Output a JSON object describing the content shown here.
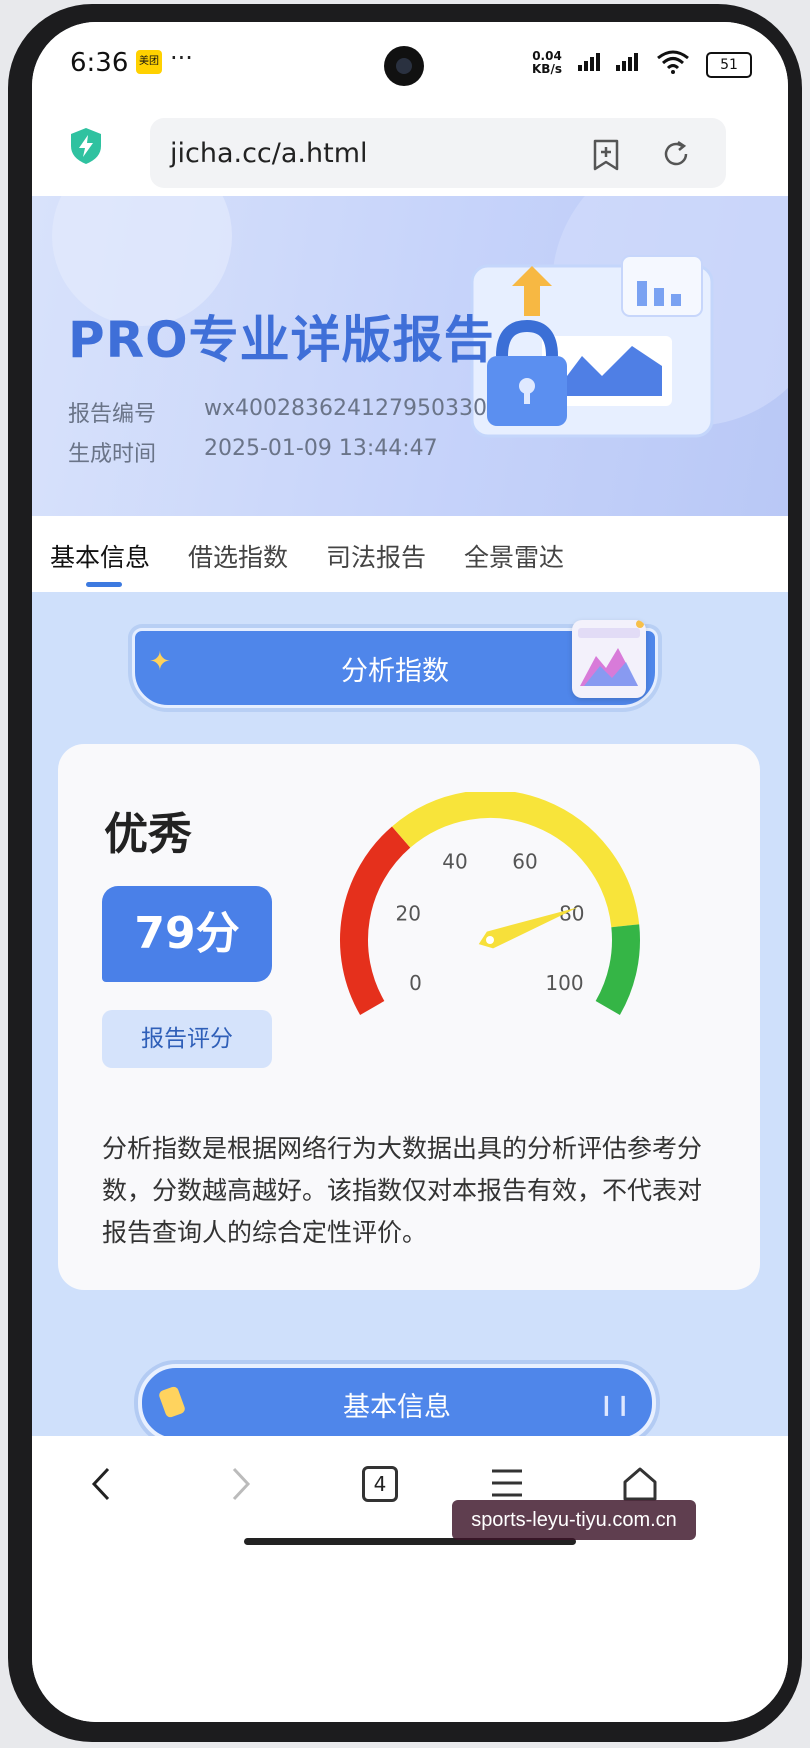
{
  "status_bar": {
    "time": "6:36",
    "app_badge": "美团",
    "more": "···",
    "net_speed_value": "0.04",
    "net_speed_unit": "KB/s",
    "battery": "51"
  },
  "browser": {
    "url": "jicha.cc/a.html",
    "tab_count": "4"
  },
  "hero": {
    "title": "PRO专业详版报告",
    "report_id_label": "报告编号",
    "report_id_value": "wx400283624127950330",
    "generated_label": "生成时间",
    "generated_value": "2025-01-09 13:44:47"
  },
  "tabs": [
    {
      "label": "基本信息",
      "active": true
    },
    {
      "label": "借选指数",
      "active": false
    },
    {
      "label": "司法报告",
      "active": false
    },
    {
      "label": "全景雷达",
      "active": false
    }
  ],
  "analysis": {
    "banner_label": "分析指数",
    "grade": "优秀",
    "score_text": "79分",
    "score_value": 79,
    "score_label": "报告评分",
    "gauge_ticks": [
      "0",
      "20",
      "40",
      "60",
      "80",
      "100"
    ],
    "description": "分析指数是根据网络行为大数据出具的分析评估参考分数，分数越高越好。该指数仅对本报告有效，不代表对报告查询人的综合定性评价。",
    "colors": {
      "red": "#e5301c",
      "yellow": "#f8e43a",
      "green": "#35b546",
      "needle": "#f7e03a"
    }
  },
  "basic_info_button": "基本信息",
  "watermark": "sports-leyu-tiyu.com.cn"
}
